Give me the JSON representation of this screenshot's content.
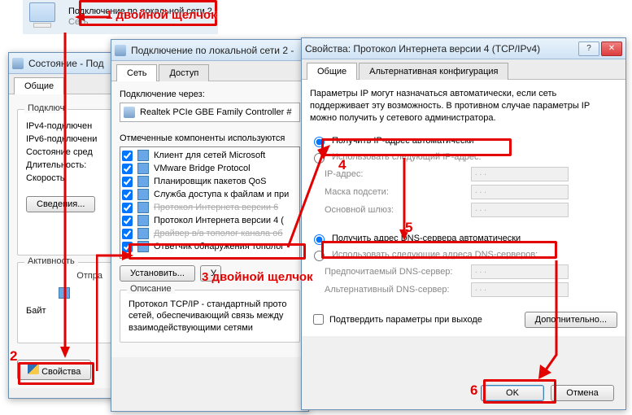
{
  "net_icon": {
    "title": "Подключение по локальной сети 2",
    "subtitle": "Сеть"
  },
  "annotations": {
    "a1": "1 двойной щелчок",
    "a2": "2",
    "a3": "3 двойной щелчок",
    "a4": "4",
    "a5": "5",
    "a6": "6"
  },
  "win_status": {
    "title": "Состояние - Под",
    "tab_general": "Общие",
    "grp_conn": "Подключ",
    "ipv4": "IPv4-подключен",
    "ipv6": "IPv6-подключени",
    "media": "Состояние сред",
    "duration": "Длительность:",
    "speed": "Скорость:",
    "btn_details": "Сведения...",
    "grp_activity": "Активность",
    "bytes": "Байт",
    "sent": "Отпра",
    "btn_props": "Свойства"
  },
  "win_props": {
    "title": "Подключение по локальной сети 2 - ",
    "tab_net": "Сеть",
    "tab_access": "Доступ",
    "lbl_conn_via": "Подключение через:",
    "adapter": "Realtek PCIe GBE Family Controller #",
    "lbl_components": "Отмеченные компоненты используются",
    "components": [
      "Клиент для сетей Microsoft",
      "VMware Bridge Protocol",
      "Планировщик пакетов QoS",
      "Служба доступа к файлам и при",
      "Протокол Интернета версии 6",
      "Протокол Интернета версии 4 (",
      "Драйвер в/в тополог канала об",
      "Ответчик обнаружения тополог"
    ],
    "btn_install": "Установить...",
    "btn_uninstall": "У",
    "grp_desc": "Описание",
    "desc_text": "Протокол TCP/IP - стандартный прото сетей, обеспечивающий связь между взаимодействующими сетями"
  },
  "win_tcpip": {
    "title": "Свойства: Протокол Интернета версии 4 (TCP/IPv4)",
    "tab_general": "Общие",
    "tab_alt": "Альтернативная конфигурация",
    "info": "Параметры IP могут назначаться автоматически, если сеть поддерживает эту возможность. В противном случае параметры IP можно получить у сетевого администратора.",
    "r_ip_auto": "Получить IP-адрес автоматически",
    "r_ip_manual": "Использовать следующий IP-адрес:",
    "f_ip": "IP-адрес:",
    "f_mask": "Маска подсети:",
    "f_gw": "Основной шлюз:",
    "r_dns_auto": "Получить адрес DNS-сервера автоматически",
    "r_dns_manual": "Использовать следующие адреса DNS-серверов:",
    "f_dns1": "Предпочитаемый DNS-сервер:",
    "f_dns2": "Альтернативный DNS-сервер:",
    "chk_validate": "Подтвердить параметры при выходе",
    "btn_adv": "Дополнительно...",
    "btn_ok": "OK",
    "btn_cancel": "Отмена"
  }
}
